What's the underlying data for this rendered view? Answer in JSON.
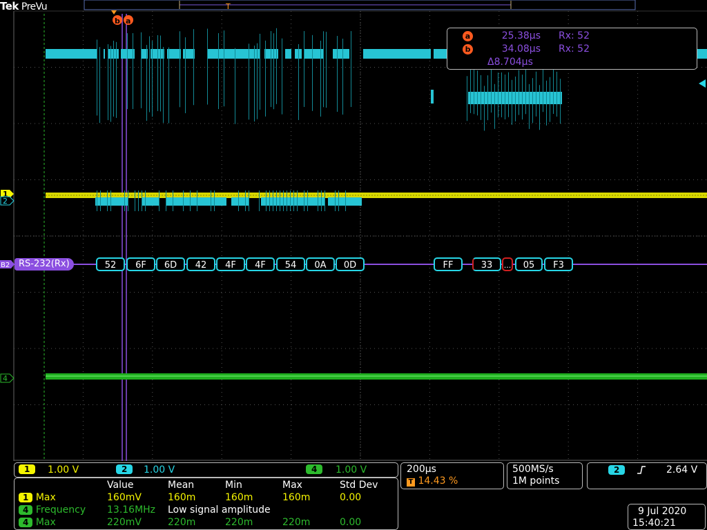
{
  "header": {
    "brand": "Tek",
    "mode": "PreVu"
  },
  "cursors": {
    "a": {
      "marker": "a",
      "time": "25.38µs",
      "value": "Rx: 52"
    },
    "b": {
      "marker": "b",
      "time": "34.08µs",
      "value": "Rx: 52"
    },
    "delta": "Δ8.704µs"
  },
  "channel_markers": {
    "ch1": "1",
    "ch2": "2",
    "ch4": "4",
    "bus": "B2"
  },
  "bus": {
    "label": "RS-232(Rx)",
    "bytes": [
      "52",
      "6F",
      "6D",
      "42",
      "4F",
      "4F",
      "54",
      "0A",
      "0D",
      "FF",
      "33",
      "...",
      "05",
      "F3"
    ]
  },
  "channels": [
    {
      "num": "1",
      "scale": "1.00 V",
      "color": "#f5f500"
    },
    {
      "num": "2",
      "scale": "1.00 V",
      "color": "#27d6e6"
    },
    {
      "num": "4",
      "scale": "1.00 V",
      "color": "#2dbb2d"
    }
  ],
  "measurements": {
    "headers": [
      "Value",
      "Mean",
      "Min",
      "Max",
      "Std Dev"
    ],
    "rows": [
      {
        "ch": "1",
        "name": "Max",
        "value": "160mV",
        "mean": "160m",
        "min": "160m",
        "max": "160m",
        "std": "0.00"
      },
      {
        "ch": "4",
        "name": "Frequency",
        "value": "13.16MHz",
        "note": "Low signal amplitude"
      },
      {
        "ch": "4",
        "name": "Max",
        "value": "220mV",
        "mean": "220m",
        "min": "220m",
        "max": "220m",
        "std": "0.00"
      }
    ]
  },
  "timebase": {
    "scale": "200µs",
    "trigger_pos": "14.43 %",
    "trigger_icon": "T"
  },
  "acquisition": {
    "rate": "500MS/s",
    "points": "1M points"
  },
  "trigger": {
    "source": "2",
    "slope": "rising-edge-icon",
    "level": "2.64 V"
  },
  "datetime": {
    "date": "9 Jul  2020",
    "time": "15:40:21"
  }
}
